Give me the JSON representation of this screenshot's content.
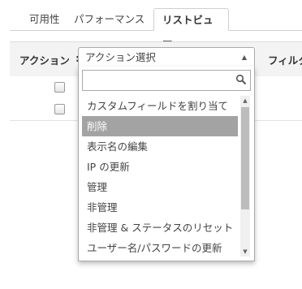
{
  "tabs": [
    {
      "label": "可用性"
    },
    {
      "label": "パフォーマンス"
    },
    {
      "label": "リストビュー",
      "active": true
    }
  ],
  "action_bar": {
    "label": "アクション",
    "colon": ":",
    "select_value": "アクション選択",
    "filter_label": "フィルタ"
  },
  "dropdown": {
    "search_value": "",
    "highlighted_index": 1,
    "options": [
      "カスタムフィールドを割り当て",
      "削除",
      "表示名の編集",
      "IP の更新",
      "管理",
      "非管理",
      "非管理 & ステータスのリセット",
      "ユーザー名/パスワードの更新"
    ]
  },
  "icons": {
    "select_arrow": "triangle-up-icon",
    "search": "search-icon",
    "scroll_up": "scroll-up-icon",
    "scroll_down": "scroll-down-icon"
  }
}
